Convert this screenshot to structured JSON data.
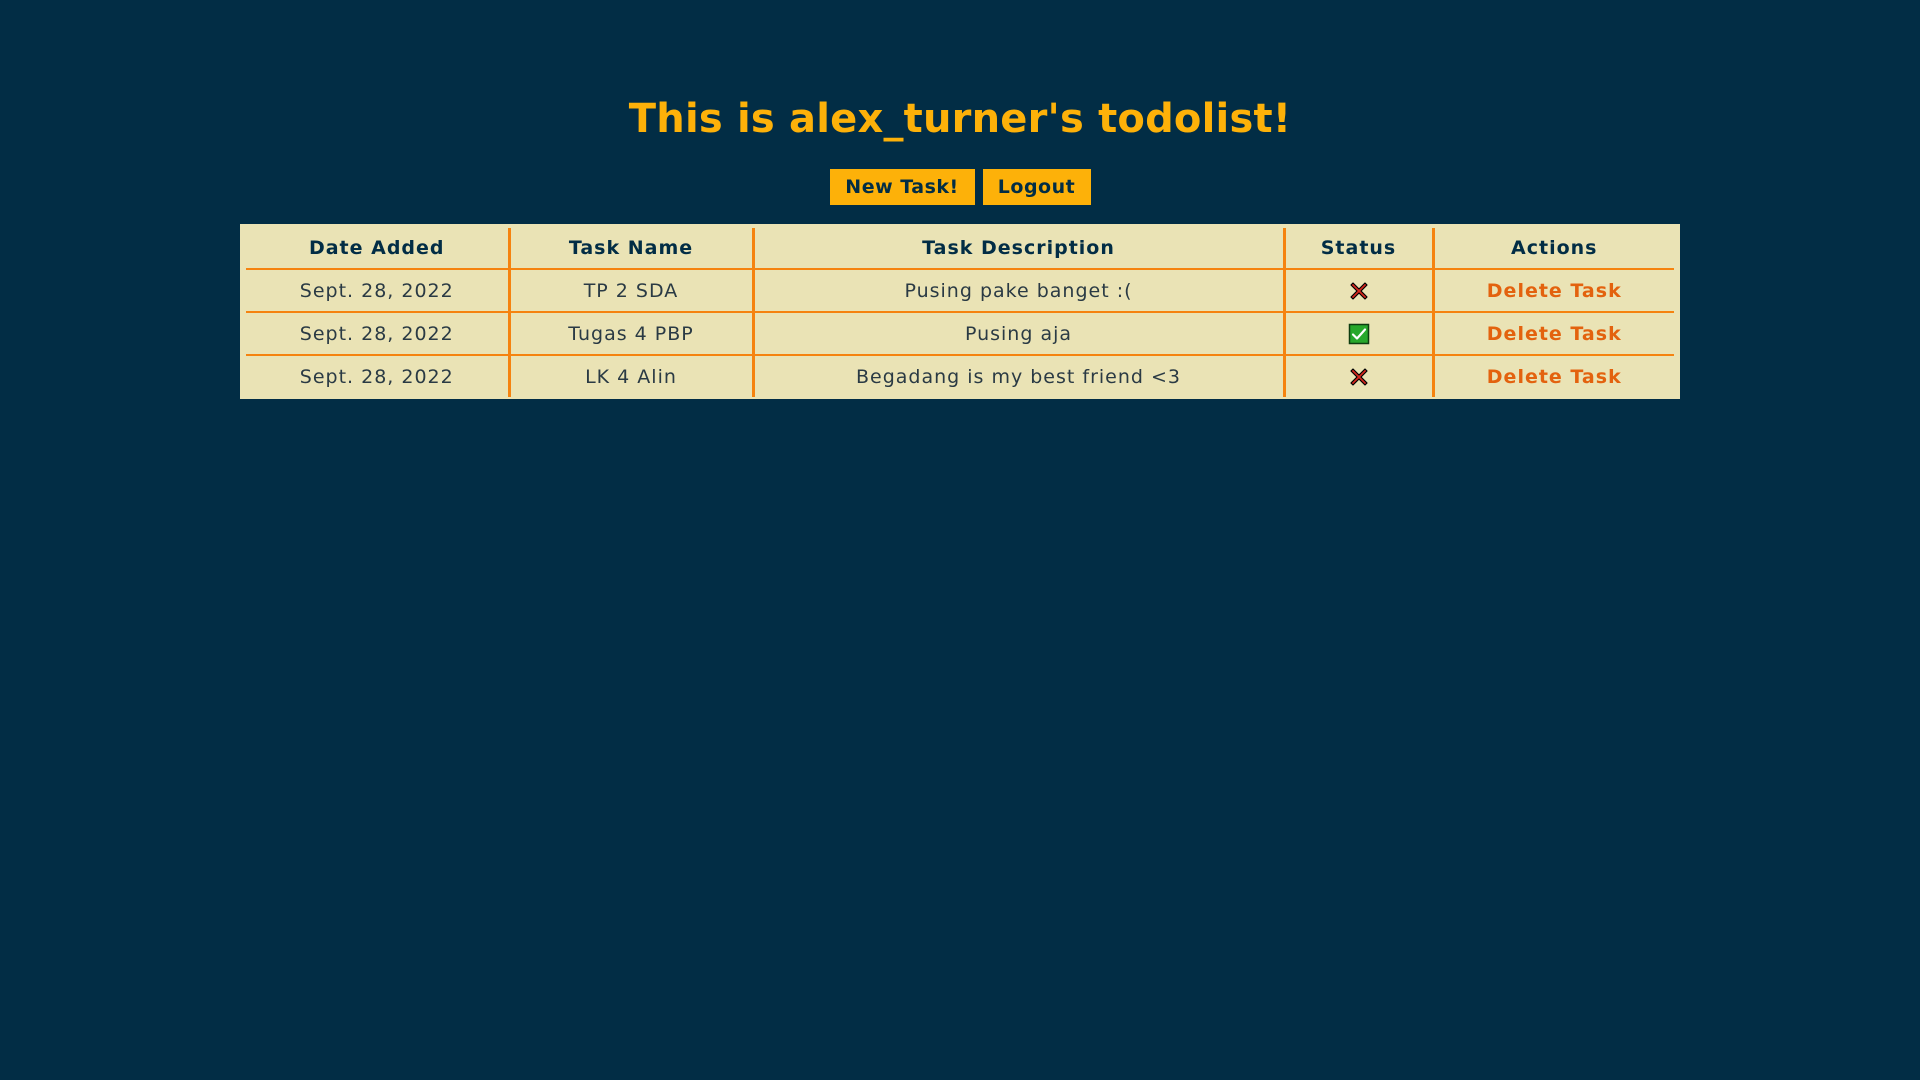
{
  "header": {
    "title": "This is alex_turner's todolist!"
  },
  "toolbar": {
    "new_task_label": "New Task!",
    "logout_label": "Logout"
  },
  "table": {
    "columns": [
      "Date Added",
      "Task Name",
      "Task Description",
      "Status",
      "Actions"
    ],
    "rows": [
      {
        "date": "Sept. 28, 2022",
        "name": "TP 2 SDA",
        "description": "Pusing pake banget :(",
        "status": "cross-icon",
        "action": "Delete Task"
      },
      {
        "date": "Sept. 28, 2022",
        "name": "Tugas 4 PBP",
        "description": "Pusing aja",
        "status": "check-icon",
        "action": "Delete Task"
      },
      {
        "date": "Sept. 28, 2022",
        "name": "LK 4 Alin",
        "description": "Begadang is my best friend <3",
        "status": "cross-icon",
        "action": "Delete Task"
      }
    ]
  },
  "colors": {
    "background": "#022d45",
    "accent": "#fdb109",
    "table_bg": "#eae3b5",
    "divider": "#f5830f",
    "link": "#e3620e"
  }
}
